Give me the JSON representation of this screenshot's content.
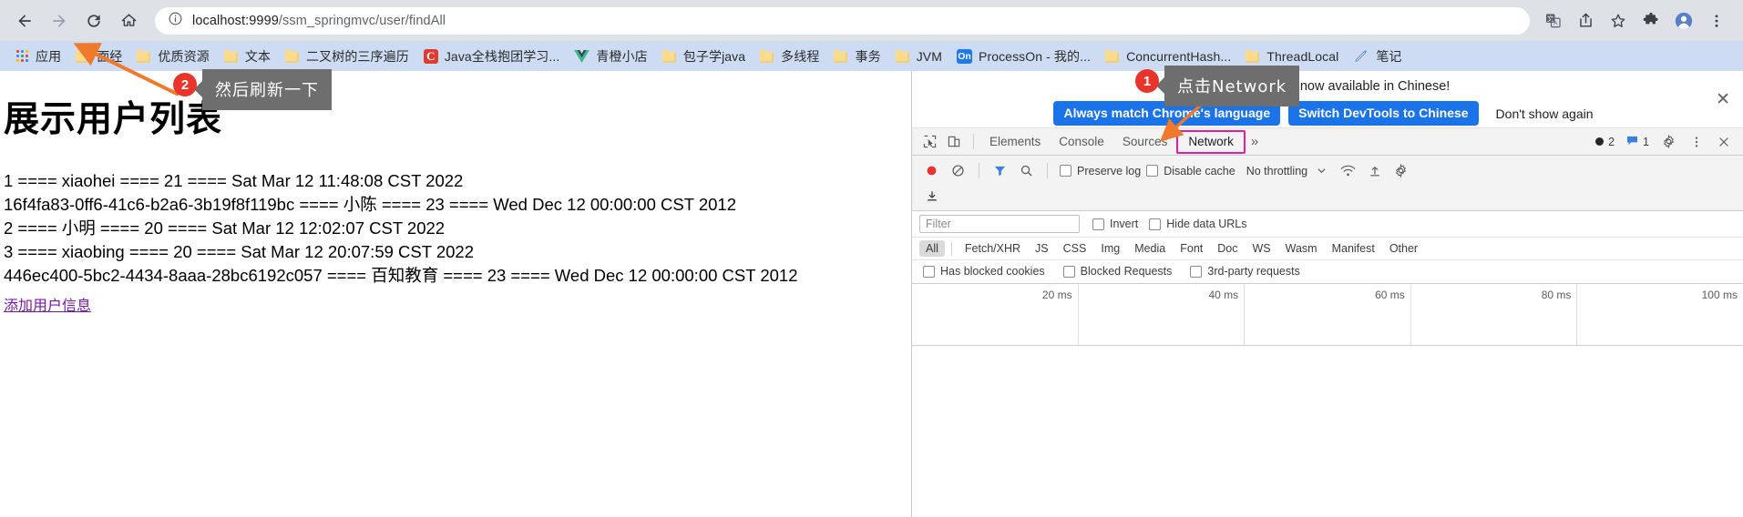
{
  "browser": {
    "nav": {
      "back_label": "Back",
      "forward_label": "Forward",
      "reload_label": "Reload",
      "home_label": "Home"
    },
    "omnibox": {
      "site_info_icon": "info-circle-icon",
      "url_host": "localhost:9999",
      "url_path": "/ssm_springmvc/user/findAll",
      "translate_icon": "translate-icon",
      "share_icon": "share-icon",
      "bookmark_star_icon": "star-icon",
      "extensions_icon": "puzzle-icon",
      "profile_icon": "profile-avatar-icon",
      "menu_icon": "three-dot-menu-icon"
    },
    "bookmarks": [
      {
        "label": "应用",
        "icon": "apps-grid-icon"
      },
      {
        "label": "面经",
        "icon": "folder-icon"
      },
      {
        "label": "优质资源",
        "icon": "folder-icon"
      },
      {
        "label": "文本",
        "icon": "folder-icon"
      },
      {
        "label": "二叉树的三序遍历",
        "icon": "folder-icon"
      },
      {
        "label": "Java全栈抱团学习...",
        "icon": "csdn-c-icon"
      },
      {
        "label": "青橙小店",
        "icon": "vue-logo-icon"
      },
      {
        "label": "包子学java",
        "icon": "folder-icon"
      },
      {
        "label": "多线程",
        "icon": "folder-icon"
      },
      {
        "label": "事务",
        "icon": "folder-icon"
      },
      {
        "label": "JVM",
        "icon": "folder-icon"
      },
      {
        "label": "ProcessOn - 我的...",
        "icon": "processon-icon"
      },
      {
        "label": "ConcurrentHash...",
        "icon": "folder-icon"
      },
      {
        "label": "ThreadLocal",
        "icon": "folder-icon"
      },
      {
        "label": "笔记",
        "icon": "pen-icon"
      }
    ]
  },
  "page": {
    "title": "展示用户列表",
    "user_lines": [
      "1 ==== xiaohei ==== 21 ==== Sat Mar 12 11:48:08 CST 2022",
      "16f4fa83-0ff6-41c6-b2a6-3b19f8f119bc ==== 小陈 ==== 23 ==== Wed Dec 12 00:00:00 CST 2012",
      "2 ==== 小明 ==== 20 ==== Sat Mar 12 12:02:07 CST 2022",
      "3 ==== xiaobing ==== 20 ==== Sat Mar 12 20:07:59 CST 2022",
      "446ec400-5bc2-4434-8aaa-28bc6192c057 ==== 百知教育 ==== 23 ==== Wed Dec 12 00:00:00 CST 2012"
    ],
    "add_user_link": "添加用户信息"
  },
  "annotations": [
    {
      "number": "1",
      "text": "点击Network"
    },
    {
      "number": "2",
      "text": "然后刷新一下"
    }
  ],
  "devtools": {
    "banner": {
      "info_icon": "info-icon",
      "message": "DevTools is now available in Chinese!",
      "primary_button": "Always match Chrome's language",
      "secondary_button": "Switch DevTools to Chinese",
      "dismiss_button": "Don't show again",
      "close_icon": "close-icon"
    },
    "toolbar": {
      "inspect_icon": "inspect-element-icon",
      "device_toggle_icon": "device-toolbar-icon",
      "tabs": [
        "Elements",
        "Console",
        "Sources",
        "Network"
      ],
      "selected_tab": "Network",
      "more_tabs_icon": "chevron-right-more-icon",
      "error_count": "2",
      "message_count": "1",
      "settings_icon": "gear-icon",
      "more_options_icon": "three-dot-menu-icon",
      "close_icon": "close-icon"
    },
    "network_toolbar": {
      "record_icon": "record-red-circle-icon",
      "clear_icon": "clear-no-entry-icon",
      "filter_icon": "funnel-filter-icon",
      "search_icon": "search-magnifier-icon",
      "preserve_log_label": "Preserve log",
      "disable_cache_label": "Disable cache",
      "throttling_label": "No throttling",
      "throttling_caret": "chevron-down-icon",
      "wifi_icon": "network-conditions-icon",
      "import_icon": "import-har-upload-icon",
      "export_icon": "export-har-download-icon",
      "settings_icon": "gear-icon"
    },
    "filter_row": {
      "filter_placeholder": "Filter",
      "invert_label": "Invert",
      "hide_data_urls_label": "Hide data URLs"
    },
    "resource_types": [
      "All",
      "Fetch/XHR",
      "JS",
      "CSS",
      "Img",
      "Media",
      "Font",
      "Doc",
      "WS",
      "Wasm",
      "Manifest",
      "Other"
    ],
    "selected_resource_type": "All",
    "cookie_filters": {
      "has_blocked_cookies": "Has blocked cookies",
      "blocked_requests": "Blocked Requests",
      "third_party_requests": "3rd-party requests"
    },
    "timeline_ticks": [
      "20 ms",
      "40 ms",
      "60 ms",
      "80 ms",
      "100 ms"
    ]
  },
  "colors": {
    "chrome_toolbar": "#dee1e6",
    "bookmarks_bar": "#cddcf3",
    "devtools_blue": "#1a73e8",
    "annotation_red": "#e8342a",
    "annotation_gray": "#6e6e6e",
    "arrow_orange": "#f07a2c",
    "selected_tab_outline": "#e020a0",
    "link_purple": "#7a17a5"
  }
}
